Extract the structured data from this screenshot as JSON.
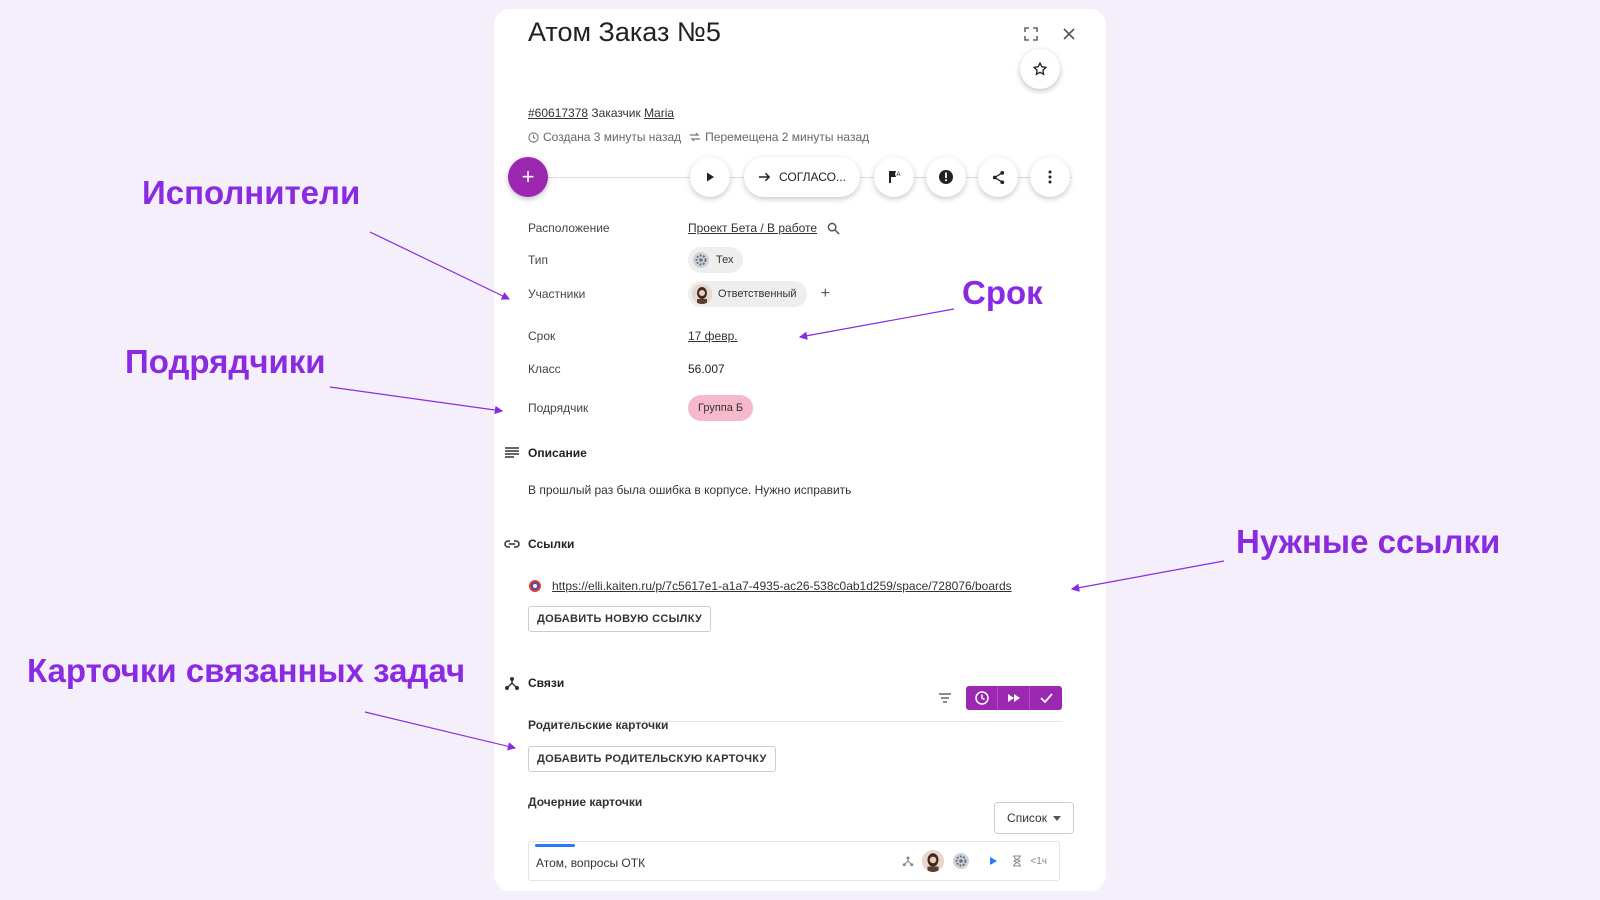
{
  "card": {
    "title": "Атом Заказ №5",
    "id_link": "#60617378",
    "customer_label": "Заказчик",
    "customer_name": "Maria",
    "created": "Создана 3 минуты назад",
    "moved": "Перемещена 2 минуты назад"
  },
  "toolbar": {
    "add_label": "+",
    "transition_label": "СОГЛАСО..."
  },
  "props": {
    "location_label": "Расположение",
    "location_value": "Проект Бета / В работе",
    "type_label": "Тип",
    "type_value": "Тех",
    "members_label": "Участники",
    "member_role": "Ответственный",
    "due_label": "Срок",
    "due_value": "17 февр.",
    "class_label": "Класс",
    "class_value": "56.007",
    "contractor_label": "Подрядчик",
    "contractor_value": "Группа Б"
  },
  "description": {
    "title": "Описание",
    "text": "В прошлый раз была ошибка в корпусе. Нужно исправить"
  },
  "links": {
    "title": "Ссылки",
    "url": "https://elli.kaiten.ru/p/7c5617e1-a1a7-4935-ac26-538c0ab1d259/space/728076/boards",
    "add_button": "ДОБАВИТЬ НОВУЮ ССЫЛКУ"
  },
  "relations": {
    "title": "Связи",
    "parents_title": "Родительские карточки",
    "add_parent_button": "ДОБАВИТЬ РОДИТЕЛЬСКУЮ КАРТОЧКУ",
    "children_title": "Дочерние карточки",
    "view_select": "Список",
    "child_name": "Атом, вопросы ОТК",
    "child_time": "<1ч"
  },
  "annotations": {
    "executors": "Исполнители",
    "contractors": "Подрядчики",
    "deadline": "Срок",
    "links": "Нужные ссылки",
    "related_cards": "Карточки связанных задач"
  },
  "colors": {
    "accent": "#9c27b0",
    "annotation": "#8a2be2",
    "background": "#f5effb",
    "contractor_chip": "#f6b9cc"
  }
}
